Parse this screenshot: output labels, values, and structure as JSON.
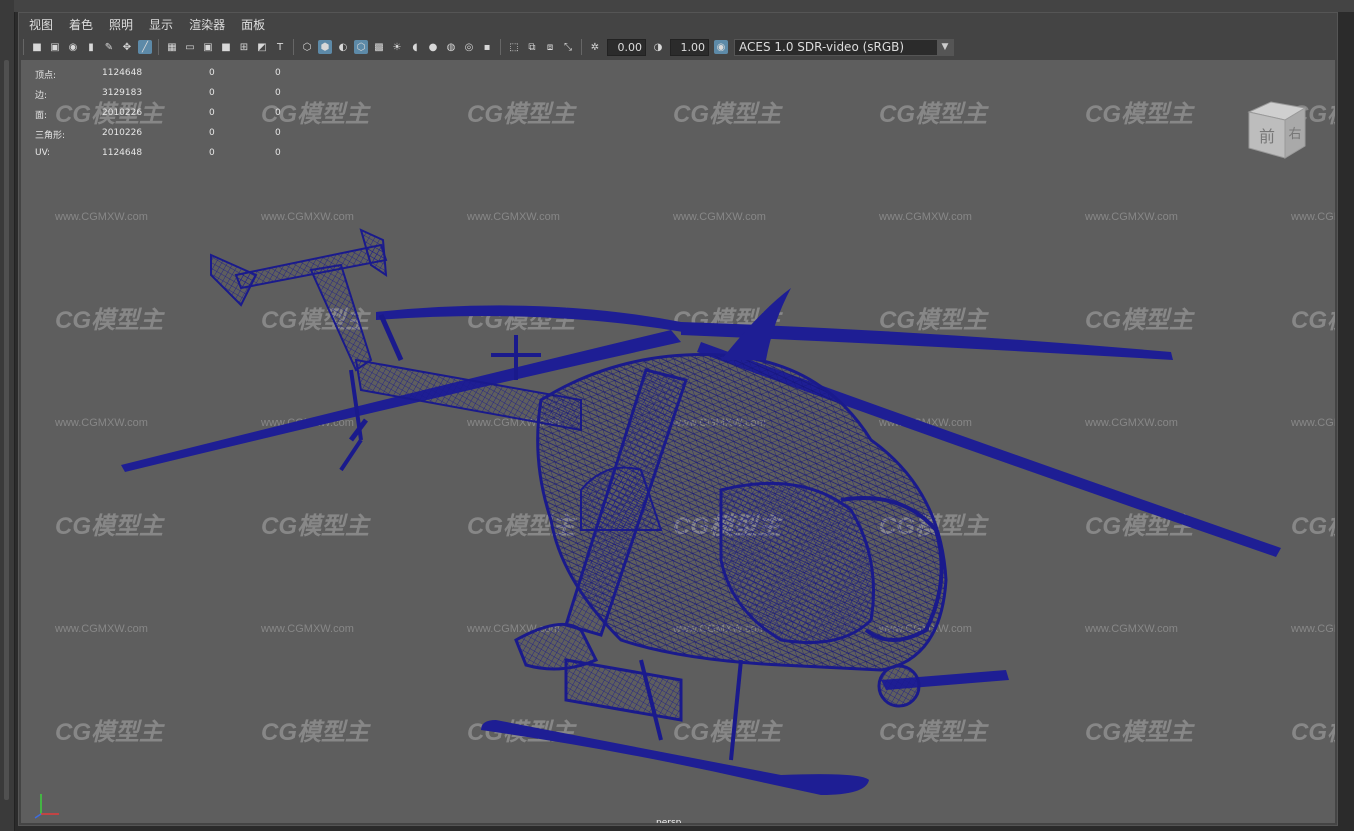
{
  "menu": [
    "视图",
    "着色",
    "照明",
    "显示",
    "渲染器",
    "面板"
  ],
  "toolbar": {
    "icons_group1": [
      "camera-icon",
      "camera-attrs-icon",
      "bookmark-icon",
      "image-plane-icon",
      "grease-pencil-icon",
      "2d-pan-icon",
      "pencil-icon"
    ],
    "icons_group2": [
      "grid-icon",
      "film-gate-icon",
      "resolution-gate-icon",
      "gate-mask-icon",
      "field-chart-icon",
      "safe-action-icon",
      "safe-title-icon"
    ],
    "icons_group3": [
      "wireframe-icon",
      "smooth-shade-icon",
      "default-material-icon",
      "wireframe-on-shaded-icon",
      "textured-icon",
      "use-lights-icon",
      "shadows-icon",
      "ambient-occlusion-icon",
      "motion-blur-icon",
      "anti-aliasing-icon",
      "depth-of-field-icon"
    ],
    "icons_group4": [
      "isolate-select-icon",
      "xray-icon",
      "xray-joints-icon",
      "xray-active-icon"
    ],
    "exposure_value": "0.00",
    "gamma_value": "1.00",
    "color_space": "ACES 1.0 SDR-video (sRGB)"
  },
  "hud": [
    {
      "label": "顶点:",
      "v1": "1124648",
      "v2": "0",
      "v3": "0"
    },
    {
      "label": "边:",
      "v1": "3129183",
      "v2": "0",
      "v3": "0"
    },
    {
      "label": "面:",
      "v1": "2010226",
      "v2": "0",
      "v3": "0"
    },
    {
      "label": "三角形:",
      "v1": "2010226",
      "v2": "0",
      "v3": "0"
    },
    {
      "label": "UV:",
      "v1": "1124648",
      "v2": "0",
      "v3": "0"
    }
  ],
  "viewcube": {
    "front": "前",
    "right": "右"
  },
  "camera_label": "persp",
  "watermark": {
    "logo": "CG模型主",
    "url": "www.CGMXW.com"
  },
  "colors": {
    "wireframe": "#1a1a8c",
    "viewport_bg": "#5e5e5e",
    "active_icon": "#5d8aa8"
  }
}
